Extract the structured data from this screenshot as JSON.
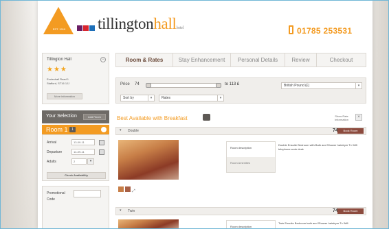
{
  "header": {
    "brand_main": "tillington",
    "brand_accent": "hall",
    "brand_suffix": "hotel",
    "logo_est": "EST. 1919",
    "phone": "01785 253531",
    "logo_colors": [
      "#6a1d64",
      "#d8262e",
      "#1d6fb8",
      "#f39b22"
    ]
  },
  "hotel_box": {
    "name": "Tillington Hall",
    "stars": "★★★",
    "address_line1": "Eccleshall Road 1",
    "address_line2": "Stafford, ST16 1JJ",
    "more_info": "More information"
  },
  "selection": {
    "title": "Your Selection",
    "add_room": "Add Room",
    "room_label": "Room 1",
    "room_count": "1",
    "arrival_label": "Arrival",
    "arrival_value": "13-09-11",
    "departure_label": "Departure",
    "departure_value": "14-09-11",
    "adults_label": "Adults",
    "adults_value": "2",
    "check_button": "Check Availability"
  },
  "promo": {
    "label_line1": "Promotional",
    "label_line2": "Code"
  },
  "tabs": [
    {
      "label": "Room & Rates"
    },
    {
      "label": "Stay Enhancement"
    },
    {
      "label": "Personal Details"
    },
    {
      "label": "Review"
    },
    {
      "label": "Checkout"
    }
  ],
  "filter": {
    "price_label": "Price",
    "price_min": "74",
    "price_max": "to 113 £",
    "currency": "British Pound (£)",
    "sort_label": "Sort by",
    "sort_value": "Rates"
  },
  "results": {
    "heading": "Best Available with Breakfast",
    "show_rate_info": "Show Rate Information",
    "close": "×",
    "rooms": [
      {
        "name": "Double",
        "price": "74.00 £",
        "book": "Book Room",
        "tab_description": "Room description",
        "tab_amenities": "Room Amenities",
        "description": "Double Ensuite Bedroom with Bath and Shower hairdryer Tv Wifi telephone work desk"
      },
      {
        "name": "Twin",
        "price": "74.00 £",
        "book": "Book Room",
        "tab_description": "Room description",
        "description": "Twin Ensuite Bedroom bath and Shower hairdryer Tv Wifi"
      }
    ]
  }
}
